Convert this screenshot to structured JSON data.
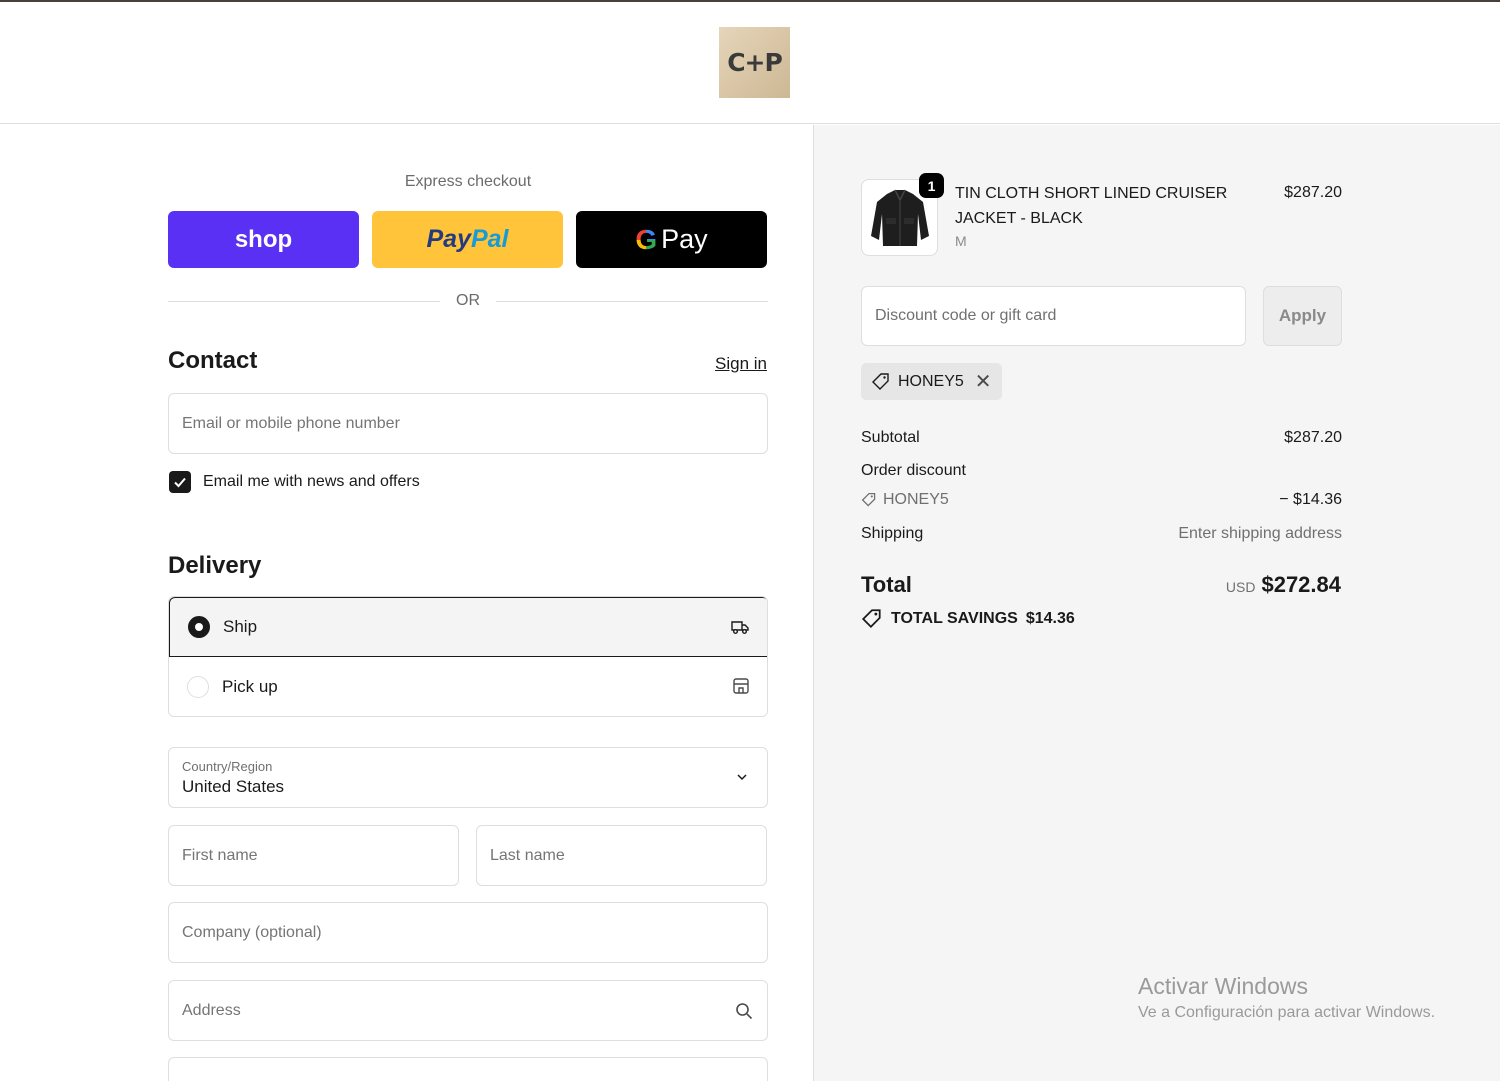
{
  "header": {
    "logo_text": "C+P"
  },
  "express": {
    "label": "Express checkout",
    "shop_label": "shop",
    "paypal_part1": "Pay",
    "paypal_part2": "Pal",
    "gpay_g": "G",
    "gpay_label": "Pay",
    "or_text": "OR"
  },
  "contact": {
    "title": "Contact",
    "signin_label": "Sign in",
    "email_placeholder": "Email or mobile phone number",
    "newsletter_label": "Email me with news and offers",
    "newsletter_checked": true
  },
  "delivery": {
    "title": "Delivery",
    "options": [
      {
        "label": "Ship",
        "selected": true,
        "icon": "truck-icon"
      },
      {
        "label": "Pick up",
        "selected": false,
        "icon": "store-icon"
      }
    ],
    "country_label": "Country/Region",
    "country_value": "United States",
    "first_name_placeholder": "First name",
    "last_name_placeholder": "Last name",
    "company_placeholder": "Company (optional)",
    "address_placeholder": "Address"
  },
  "order": {
    "item": {
      "name": "TIN CLOTH SHORT LINED CRUISER JACKET - BLACK",
      "variant": "M",
      "price": "$287.20",
      "quantity": "1"
    },
    "discount_placeholder": "Discount code or gift card",
    "apply_label": "Apply",
    "applied_code": "HONEY5",
    "subtotal_label": "Subtotal",
    "subtotal_value": "$287.20",
    "order_discount_label": "Order discount",
    "discount_code": "HONEY5",
    "discount_value": "− $14.36",
    "shipping_label": "Shipping",
    "shipping_value": "Enter shipping address",
    "total_label": "Total",
    "currency": "USD",
    "total_value": "$272.84",
    "savings_label": "TOTAL SAVINGS",
    "savings_value": "$14.36"
  },
  "watermark": {
    "line1": "Activar Windows",
    "line2": "Ve a Configuración para activar Windows."
  },
  "colors": {
    "shop": "#5a31f4",
    "paypal": "#ffc439",
    "gpay": "#000000",
    "panel_bg": "#f5f5f5"
  }
}
